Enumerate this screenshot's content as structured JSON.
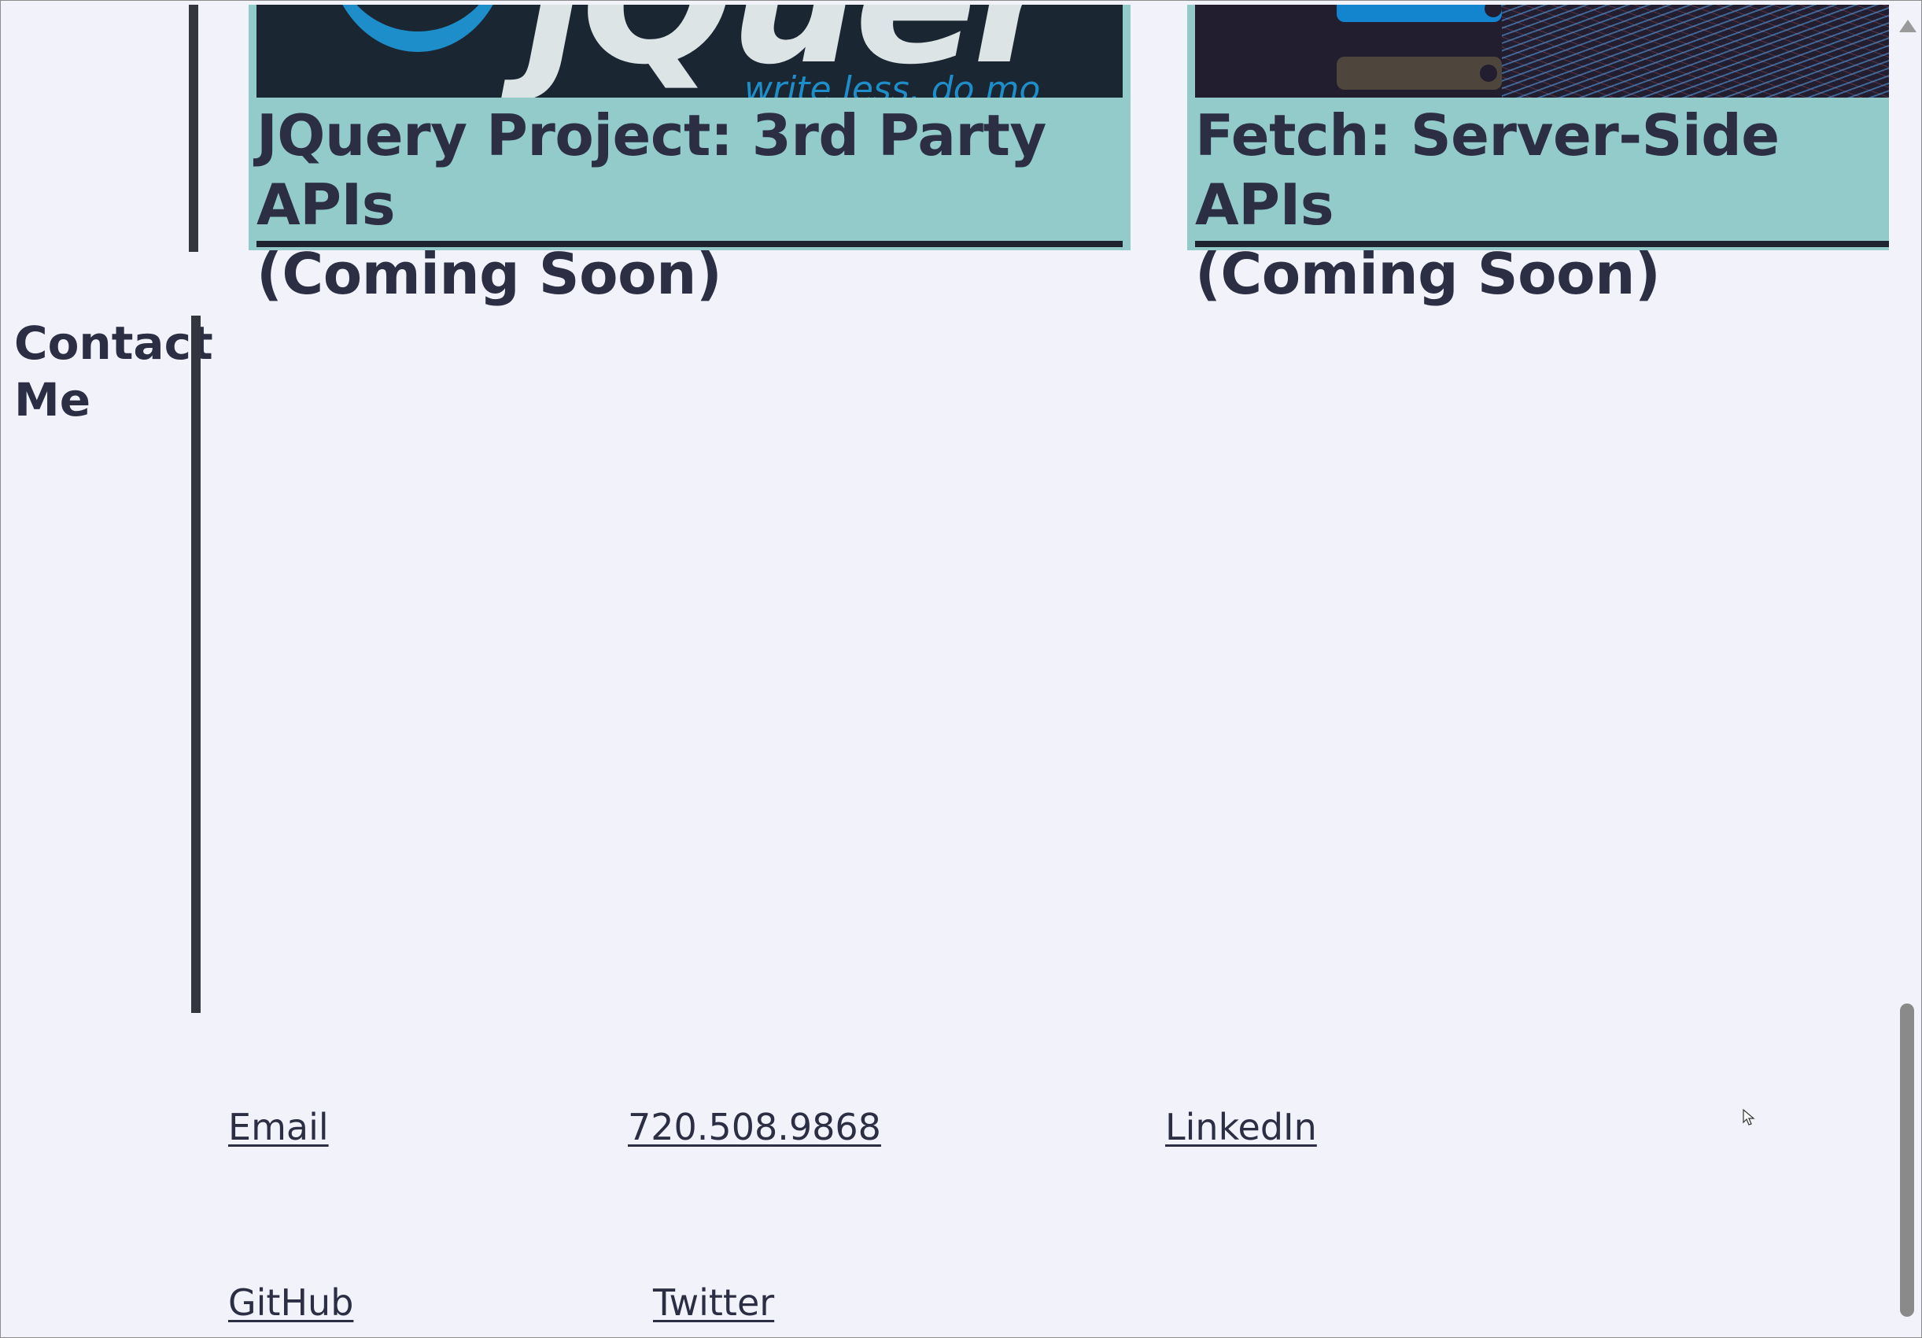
{
  "projects": [
    {
      "title_line1": "JQuery Project: 3rd Party APIs",
      "title_line2": "(Coming Soon)",
      "image": {
        "logo_text": "jQuer",
        "tagline": "write less, do mo"
      }
    },
    {
      "title_line1": "Fetch: Server-Side APIs",
      "title_line2": "(Coming Soon)"
    }
  ],
  "contact": {
    "heading_line1": "Contact",
    "heading_line2": "Me",
    "links": {
      "email": "Email",
      "phone": "720.508.9868",
      "linkedin": "LinkedIn",
      "github": "GitHub",
      "twitter": "Twitter"
    }
  },
  "colors": {
    "background": "#f2f3fa",
    "card": "#93cbcb",
    "text": "#2c2f44",
    "rule": "#33353f"
  }
}
